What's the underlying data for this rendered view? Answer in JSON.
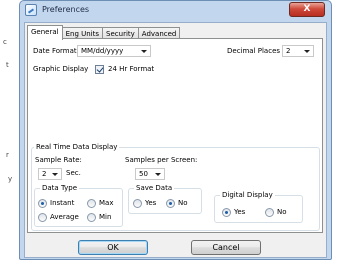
{
  "background_text": [
    "c",
    "t",
    "r",
    "y"
  ],
  "window": {
    "title": "Preferences",
    "close_label": "X"
  },
  "tabs": [
    {
      "label": "General",
      "active": true
    },
    {
      "label": "Eng Units",
      "active": false
    },
    {
      "label": "Security",
      "active": false
    },
    {
      "label": "Advanced",
      "active": false
    }
  ],
  "general": {
    "date_format_label": "Date Format",
    "date_format_value": "MM/dd/yyyy",
    "decimal_places_label": "Decimal Places",
    "decimal_places_value": "2",
    "graphic_display_label": "Graphic Display",
    "hr24_label": "24 Hr Format",
    "hr24_checked": true
  },
  "realtime": {
    "label": "Real Time Data Display",
    "sample_rate_label": "Sample Rate:",
    "sample_rate_value": "2",
    "sample_rate_unit": "Sec.",
    "samples_per_screen_label": "Samples per Screen:",
    "samples_per_screen_value": "50",
    "data_type": {
      "label": "Data Type",
      "options": [
        "Instant",
        "Max",
        "Average",
        "Min"
      ],
      "selected": "Instant"
    },
    "save_data": {
      "label": "Save Data",
      "options": [
        "Yes",
        "No"
      ],
      "selected": "No"
    },
    "digital_display": {
      "label": "Digital Display",
      "options": [
        "Yes",
        "No"
      ],
      "selected": "Yes"
    }
  },
  "buttons": {
    "ok": "OK",
    "cancel": "Cancel"
  }
}
